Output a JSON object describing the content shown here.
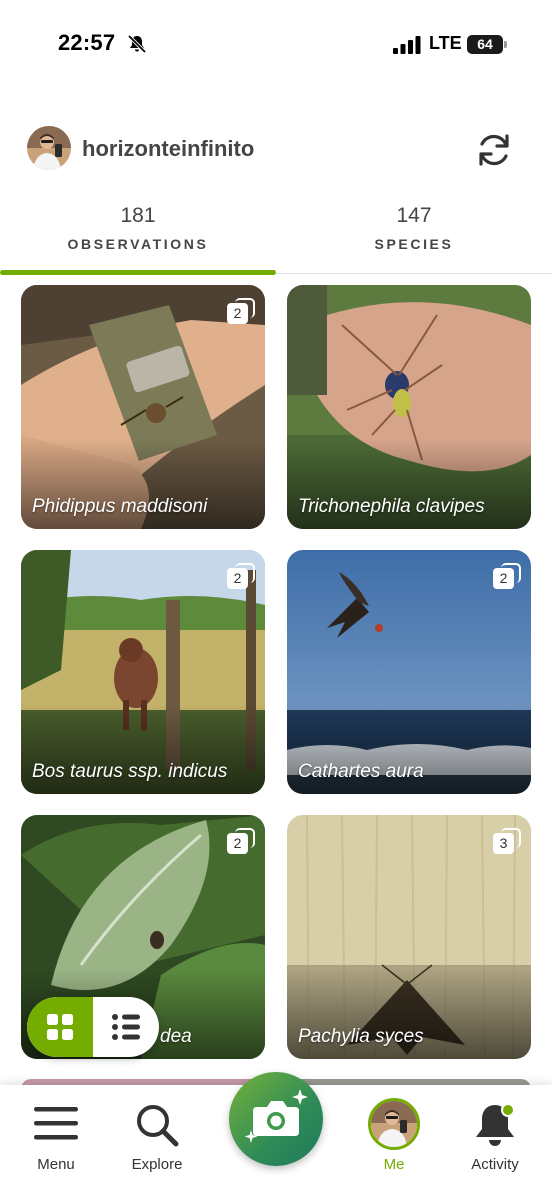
{
  "status_bar": {
    "time": "22:57",
    "network": "LTE",
    "battery": "64",
    "icons": [
      "bell-slash-icon",
      "signal-icon",
      "battery-icon"
    ]
  },
  "profile": {
    "username": "horizonteinfinito",
    "icons": [
      "avatar",
      "refresh-icon"
    ]
  },
  "tabs": [
    {
      "count": "181",
      "label": "OBSERVATIONS",
      "active": true
    },
    {
      "count": "147",
      "label": "SPECIES",
      "active": false
    }
  ],
  "observations": [
    {
      "name": "Phidippus maddisoni",
      "photo_count": "2"
    },
    {
      "name": "Trichonephila clavipes",
      "photo_count": ""
    },
    {
      "name": "Bos taurus ssp. indicus",
      "photo_count": "2"
    },
    {
      "name": "Cathartes aura",
      "photo_count": "2"
    },
    {
      "name": "dea",
      "photo_count": "2"
    },
    {
      "name": "Pachylia syces",
      "photo_count": "3"
    }
  ],
  "view_toggle": {
    "options": [
      "grid-icon",
      "list-icon"
    ],
    "selected": "grid"
  },
  "nav": {
    "menu": "Menu",
    "explore": "Explore",
    "me": "Me",
    "activity": "Activity"
  },
  "colors": {
    "accent": "#74ac00",
    "text": "#454545"
  }
}
